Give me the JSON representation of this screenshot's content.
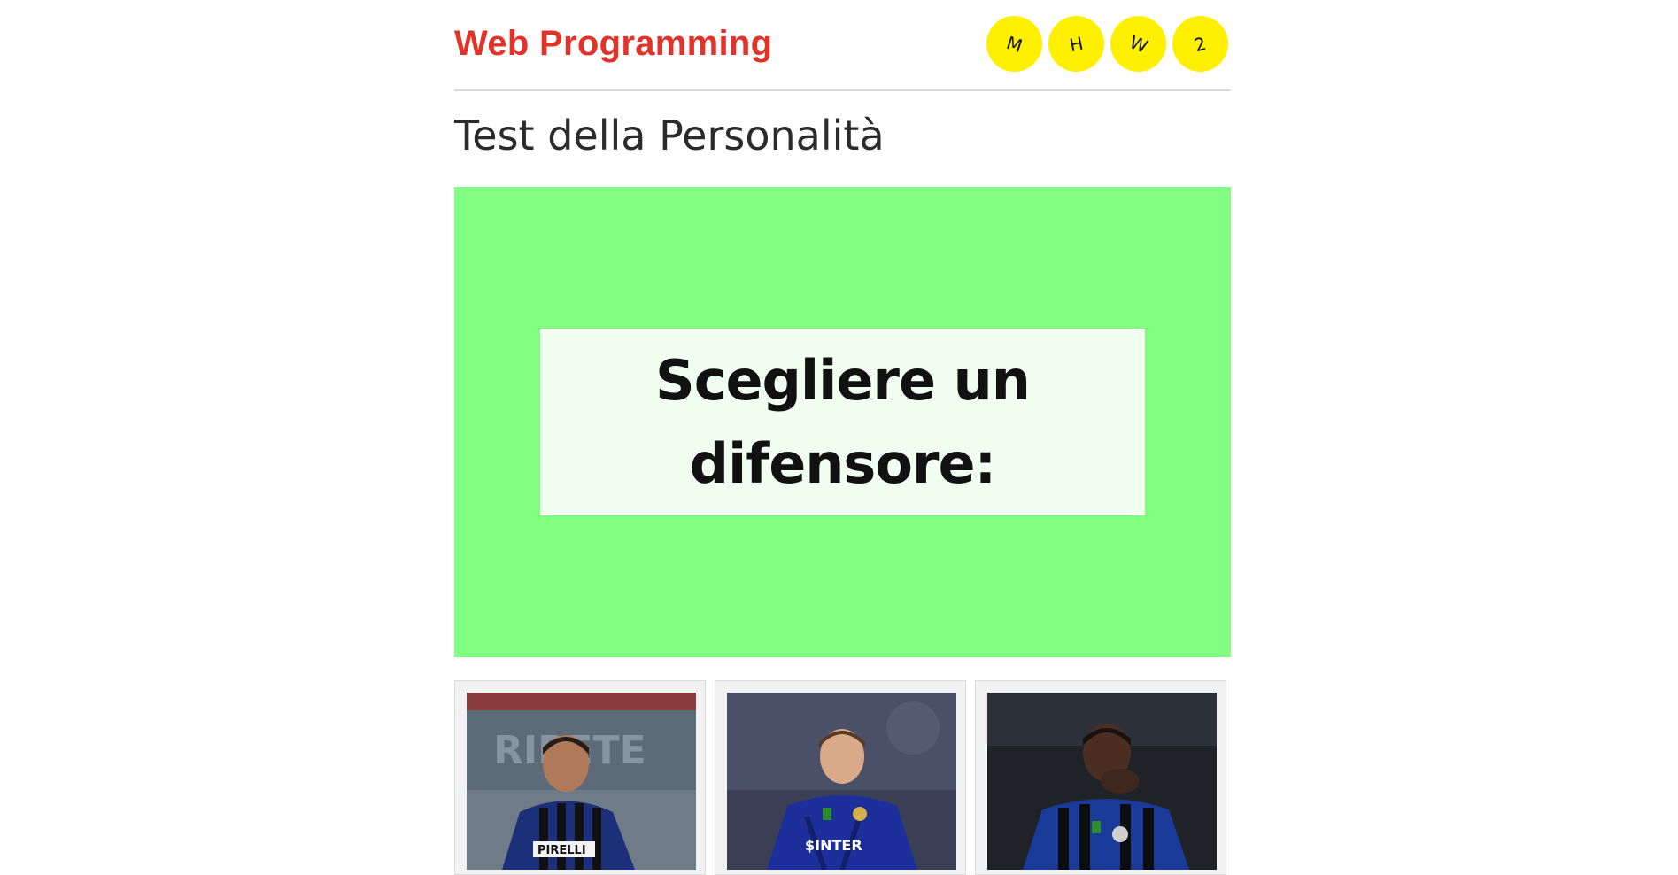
{
  "header": {
    "site_title": "Web Programming",
    "badges": [
      "M",
      "H",
      "W",
      "2"
    ]
  },
  "page": {
    "title": "Test della Personalità"
  },
  "question": {
    "line1": "Scegliere un",
    "line2": "difensore:"
  },
  "colors": {
    "accent_red": "#e2332a",
    "badge_yellow": "#fff000",
    "panel_green": "#80ff80",
    "question_box": "#f0fff0"
  },
  "options": [
    {
      "image": "player-photo",
      "jersey_text": "PIRELLI"
    },
    {
      "image": "player-photo",
      "jersey_text": "$INTER"
    },
    {
      "image": "player-photo",
      "jersey_text": ""
    }
  ]
}
